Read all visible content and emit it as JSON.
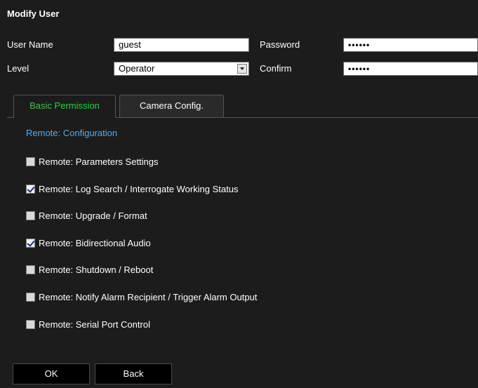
{
  "dialog": {
    "title": "Modify User"
  },
  "form": {
    "username_label": "User Name",
    "username_value": "guest",
    "password_label": "Password",
    "password_value": "••••••",
    "level_label": "Level",
    "level_value": "Operator",
    "confirm_label": "Confirm",
    "confirm_value": "••••••"
  },
  "tabs": [
    {
      "label": "Basic Permission",
      "active": true
    },
    {
      "label": "Camera Config.",
      "active": false
    }
  ],
  "section": {
    "title": "Remote: Configuration"
  },
  "permissions": [
    {
      "label": "Remote: Parameters Settings",
      "checked": false
    },
    {
      "label": "Remote: Log Search / Interrogate Working Status",
      "checked": true
    },
    {
      "label": "Remote: Upgrade / Format",
      "checked": false
    },
    {
      "label": "Remote: Bidirectional Audio",
      "checked": true
    },
    {
      "label": "Remote: Shutdown / Reboot",
      "checked": false
    },
    {
      "label": "Remote: Notify Alarm Recipient / Trigger Alarm Output",
      "checked": false
    },
    {
      "label": "Remote: Serial Port Control",
      "checked": false
    }
  ],
  "buttons": {
    "ok_label": "OK",
    "back_label": "Back"
  },
  "colors": {
    "background": "#1c1c1c",
    "active_tab_text": "#2ecc40",
    "section_title": "#5aa8e8"
  }
}
